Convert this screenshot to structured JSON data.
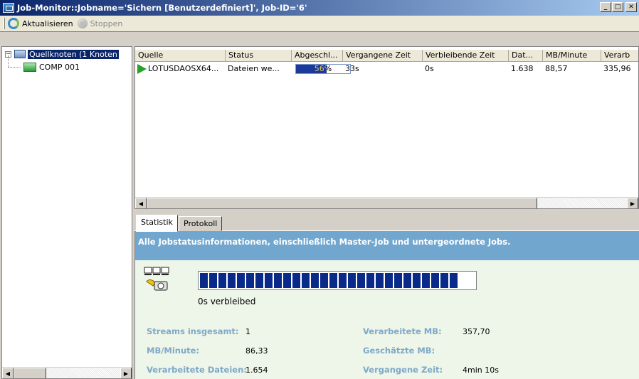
{
  "window": {
    "title": "Job-Monitor::Jobname='Sichern [Benutzerdefiniert]', Job-ID='6'",
    "buttons": {
      "minimize": "_",
      "maximize": "□",
      "close": "✕"
    }
  },
  "toolbar": {
    "refresh_label": "Aktualisieren",
    "stop_label": "Stoppen"
  },
  "tree": {
    "expander": "−",
    "root_label": "Quellknoten (1 Knoten",
    "child_label": "COMP 001"
  },
  "list": {
    "columns": [
      "Quelle",
      "Status",
      "Abgeschl...",
      "Vergangene Zeit",
      "Verbleibende Zeit",
      "Dat...",
      "MB/Minute",
      "Verarb"
    ],
    "row": {
      "source": "LOTUSDAOSX64...",
      "status": "Dateien we...",
      "completed_percent": 56,
      "completed_label": "56%",
      "elapsed": "33s",
      "remaining": "0s",
      "files": "1.638",
      "mb_per_minute": "88,57",
      "processed": "335,96"
    }
  },
  "tabs": [
    "Statistik",
    "Protokoll"
  ],
  "detail": {
    "header": "Alle Jobstatusinformationen, einschließlich Master-Job und untergeordnete Jobs.",
    "remaining_text": "0s verbleibed",
    "progress_segments_filled": 28,
    "stats": {
      "streams_label": "Streams insgesamt:",
      "streams_value": "1",
      "processed_mb_label": "Verarbeitete MB:",
      "processed_mb_value": "357,70",
      "mb_min_label": "MB/Minute:",
      "mb_min_value": "86,33",
      "estimated_mb_label": "Geschätzte MB:",
      "processed_files_label": "Verarbeitete Dateien:",
      "processed_files_value": "1.654",
      "elapsed_label": "Vergangene Zeit:",
      "elapsed_value": "4min 10s"
    }
  },
  "colors": {
    "title_start": "#0a246a",
    "title_end": "#a6caf0",
    "detail_header": "#71a7cf",
    "detail_bg": "#edf6e8",
    "progress": "#0a2a8a",
    "stat_label": "#7fa8c9"
  }
}
